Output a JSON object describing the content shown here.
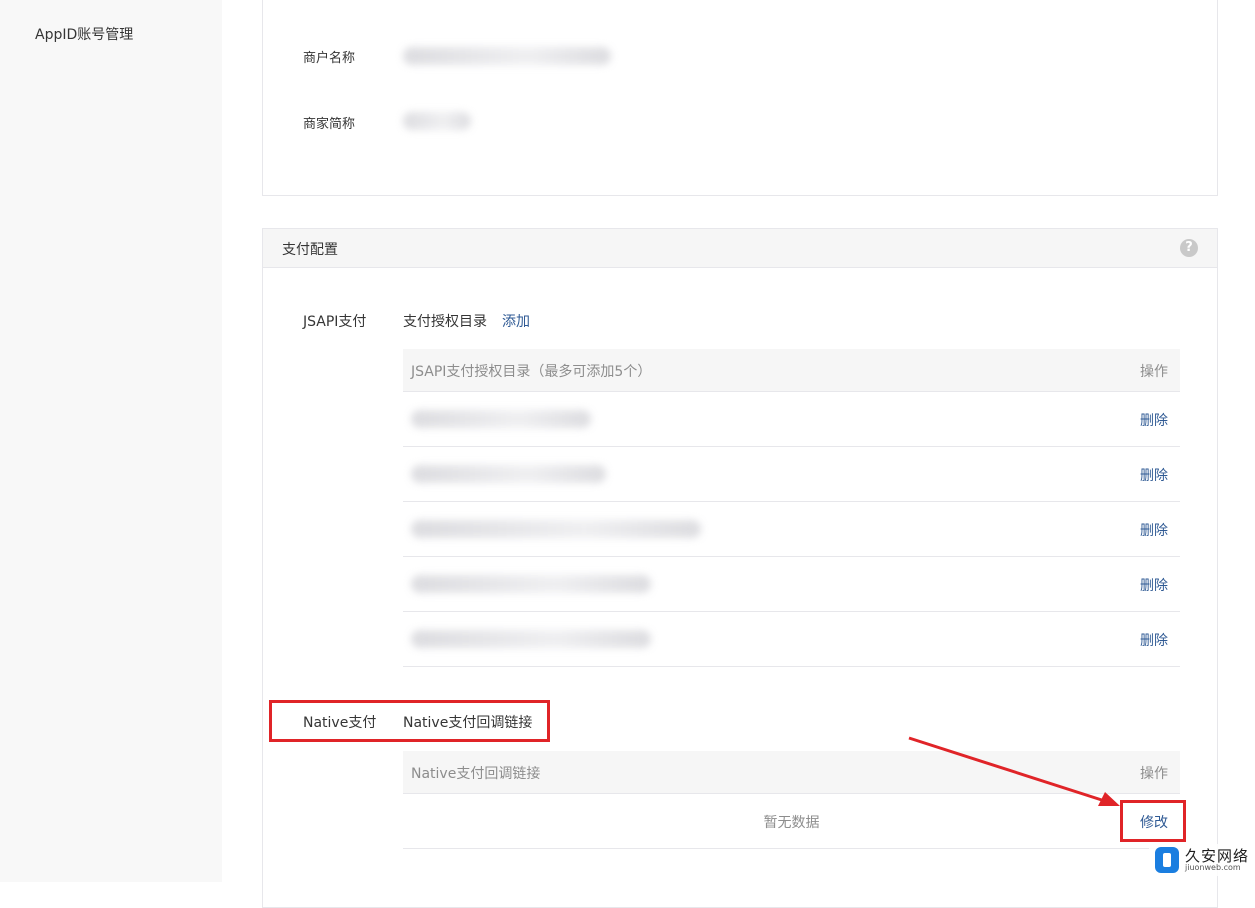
{
  "sidebar": {
    "items": [
      {
        "label": "AppID账号管理"
      }
    ]
  },
  "merchant_info": {
    "name_label": "商户名称",
    "short_name_label": "商家简称"
  },
  "pay_config": {
    "title": "支付配置",
    "help_icon": "question-circle-icon",
    "jsapi": {
      "label": "JSAPI支付",
      "dir_label": "支付授权目录",
      "add_link": "添加",
      "table": {
        "col_dir": "JSAPI支付授权目录（最多可添加5个）",
        "col_action": "操作",
        "rows": [
          {
            "action": "删除"
          },
          {
            "action": "删除"
          },
          {
            "action": "删除"
          },
          {
            "action": "删除"
          },
          {
            "action": "删除"
          }
        ]
      }
    },
    "native": {
      "label": "Native支付",
      "callback_label": "Native支付回调链接",
      "table": {
        "col_link": "Native支付回调链接",
        "col_action": "操作",
        "empty_text": "暂无数据",
        "modify_link": "修改"
      }
    }
  },
  "watermark": {
    "text": "久安网络",
    "sub": "jiuonweb.com"
  },
  "annotation_color": "#e02428"
}
